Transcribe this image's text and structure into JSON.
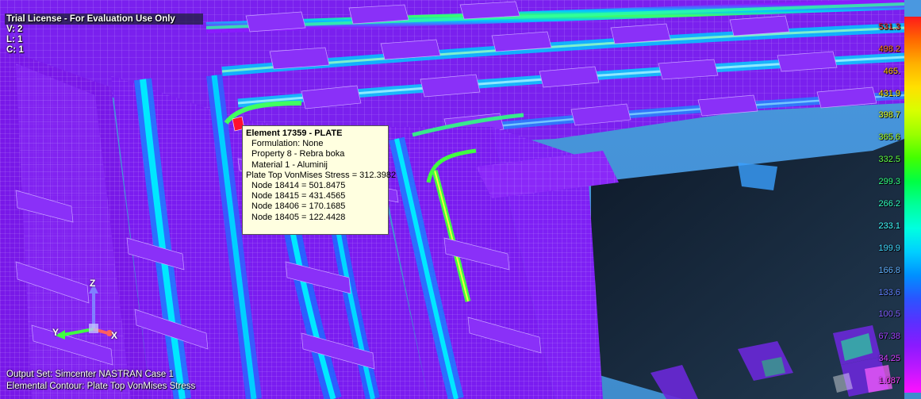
{
  "overlay": {
    "trial_license": "Trial License - For Evaluation Use Only",
    "view_info": [
      "V: 2",
      "L: 1",
      "C: 1"
    ],
    "output_set": "Output Set: Simcenter NASTRAN Case 1",
    "contour": "Elemental Contour: Plate Top VonMises Stress"
  },
  "tooltip": {
    "title": "Element 17359 - PLATE",
    "formulation": "Formulation: None",
    "property": "Property 8 - Rebra boka",
    "material": "Material 1 - Aluminij",
    "stress": "Plate Top VonMises Stress = 312.3982",
    "nodes": [
      "Node 18414 = 501.8475",
      "Node 18415 = 431.4565",
      "Node 18406 = 170.1685",
      "Node 18405 = 122.4428"
    ]
  },
  "legend": {
    "labels": [
      "531.3",
      "498.2",
      "465.",
      "431.9",
      "398.7",
      "365.6",
      "332.5",
      "299.3",
      "266.2",
      "233.1",
      "199.9",
      "166.8",
      "133.6",
      "100.5",
      "67.38",
      "34.25",
      "1.087"
    ],
    "colors": [
      "#ff1a1a",
      "#ff6a00",
      "#ffb000",
      "#ffe000",
      "#d8ff00",
      "#9aff00",
      "#44ff00",
      "#00ff44",
      "#00ff9a",
      "#00ffe0",
      "#00d0ff",
      "#0090ff",
      "#2a55ff",
      "#5a30ff",
      "#8a1aff",
      "#c018ff",
      "#ff10ff"
    ],
    "label_colors": [
      "#ff2020",
      "#ff7a10",
      "#ffc000",
      "#ffe800",
      "#e0ff20",
      "#a8ff20",
      "#60ff40",
      "#30ff80",
      "#30ffc0",
      "#40ffff",
      "#40d8ff",
      "#60b0ff",
      "#6080ff",
      "#8060ff",
      "#a040ff",
      "#d040ff",
      "#ff40ff"
    ]
  },
  "axes": {
    "x": "X",
    "y": "Y",
    "z": "Z"
  }
}
